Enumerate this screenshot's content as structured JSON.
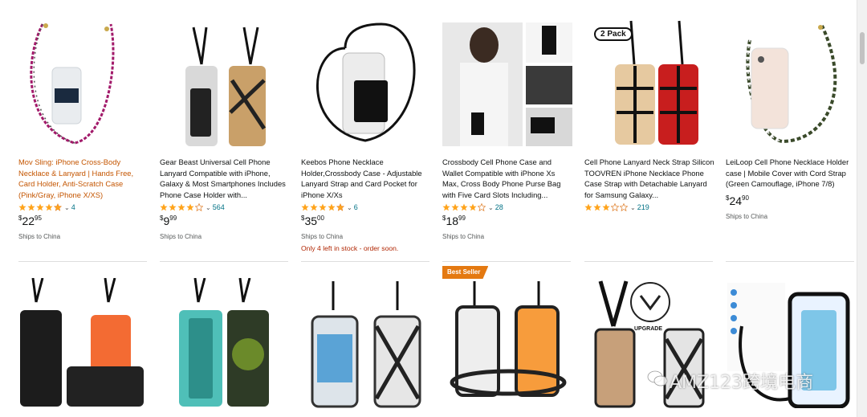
{
  "products_row1": [
    {
      "title": "Mov Sling: iPhone Cross-Body Necklace & Lanyard | Hands Free, Card Holder, Anti-Scratch Case (Pink/Gray, iPhone X/XS)",
      "rating": 4.5,
      "reviews": "4",
      "price_whole": "22",
      "price_frac": "95",
      "ships": "Ships to China",
      "stock": ""
    },
    {
      "title": "Gear Beast Universal Cell Phone Lanyard Compatible with iPhone, Galaxy & Most Smartphones Includes Phone Case Holder with...",
      "rating": 4.5,
      "reviews": "564",
      "price_whole": "9",
      "price_frac": "99",
      "ships": "Ships to China",
      "stock": ""
    },
    {
      "title": "Keebos Phone Necklace Holder,Crossbody Case - Adjustable Lanyard Strap and Card Pocket for iPhone X/Xs",
      "rating": 4.5,
      "reviews": "6",
      "price_whole": "35",
      "price_frac": "00",
      "ships": "Ships to China",
      "stock": "Only 4 left in stock - order soon."
    },
    {
      "title": "Crossbody Cell Phone Case and Wallet Compatible with iPhone Xs Max, Cross Body Phone Purse Bag with Five Card Slots Including...",
      "rating": 4,
      "reviews": "28",
      "price_whole": "18",
      "price_frac": "99",
      "ships": "Ships to China",
      "stock": ""
    },
    {
      "title": "Cell Phone Lanyard Neck Strap Silicon TOOVREN iPhone Necklace Phone Case Strap with Detachable Lanyard for Samsung Galaxy...",
      "rating": 3,
      "reviews": "219",
      "price_whole": "",
      "price_frac": "",
      "ships": "",
      "stock": ""
    },
    {
      "title": "LeiLoop Cell Phone Necklace Holder case | Mobile Cover with Cord Strap (Green Camouflage, iPhone 7/8)",
      "rating": 0,
      "reviews": "",
      "price_whole": "24",
      "price_frac": "90",
      "ships": "Ships to China",
      "stock": ""
    }
  ],
  "currency": "$",
  "pack_label": "2 Pack",
  "best_seller_label": "Best Seller",
  "upgrade_label": "UPGRADE",
  "watermark": "AMZ123跨境电商",
  "colors": {
    "star": "#ffa41c",
    "price_red": "#b12704",
    "badge": "#e47911",
    "link_orange": "#c45500"
  }
}
